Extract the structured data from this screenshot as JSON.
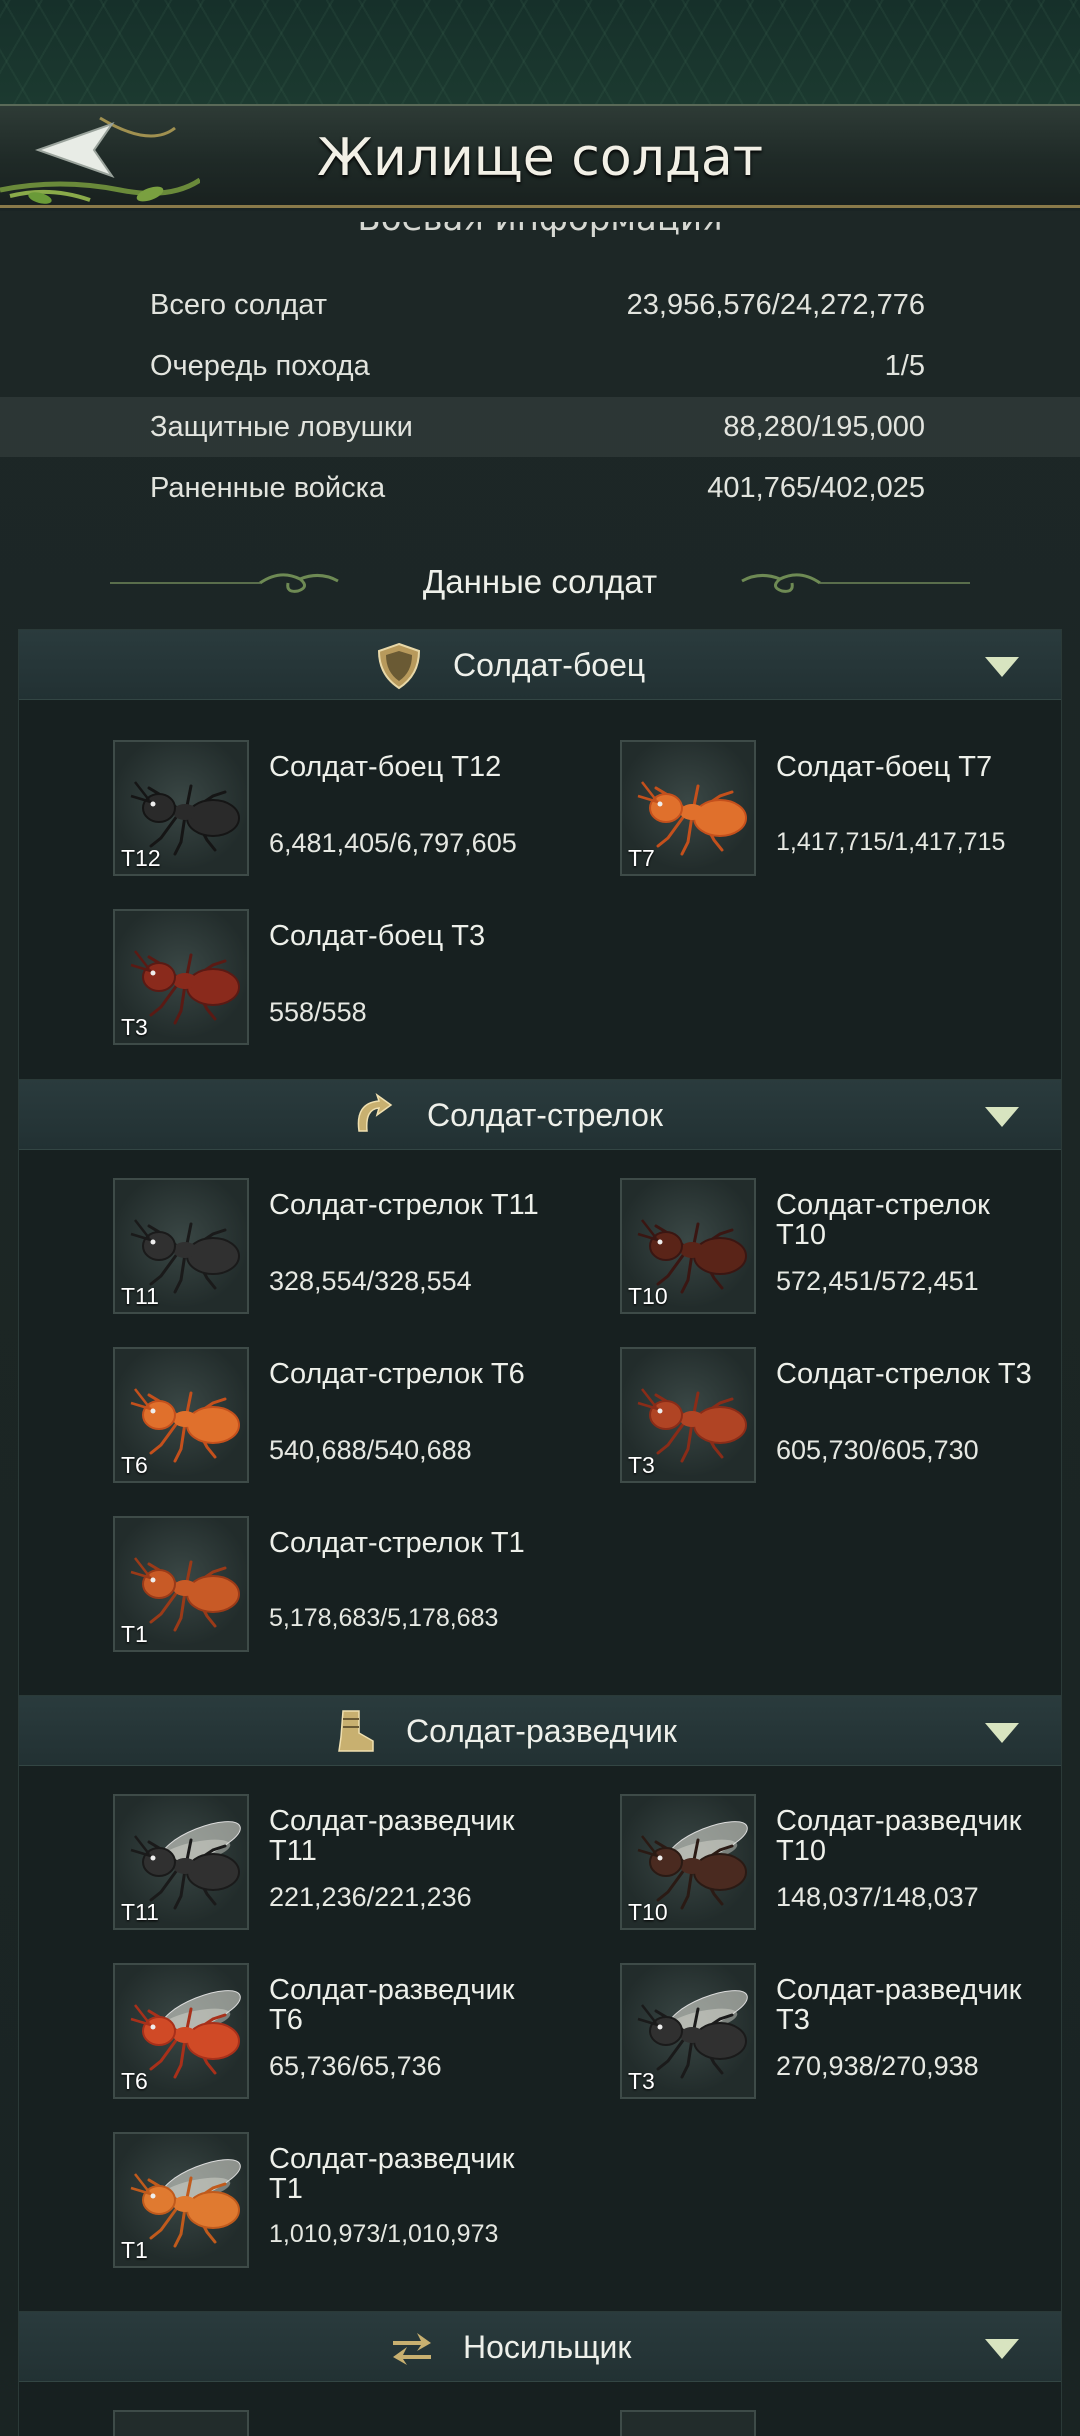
{
  "header": {
    "title": "Жилище солдат",
    "back_label": ""
  },
  "battle_info": {
    "title": "Боевая информация",
    "rows": [
      {
        "label": "Всего солдат",
        "value": "23,956,576/24,272,776"
      },
      {
        "label": "Очередь похода",
        "value": "1/5"
      },
      {
        "label": "Защитные ловушки",
        "value": "88,280/195,000"
      },
      {
        "label": "Раненные войска",
        "value": "401,765/402,025"
      }
    ]
  },
  "soldier_data_title": "Данные солдат",
  "sections": [
    {
      "name": "Солдат-боец",
      "icon": "shield-icon",
      "units": [
        {
          "name": "Солдат-боец T12",
          "count": "6,481,405/6,797,605",
          "tier": "T12"
        },
        {
          "name": "Солдат-боец T7",
          "count": "1,417,715/1,417,715",
          "tier": "T7"
        },
        {
          "name": "Солдат-боец T3",
          "count": "558/558",
          "tier": "T3"
        }
      ]
    },
    {
      "name": "Солдат-стрелок",
      "icon": "curved-arrow-icon",
      "units": [
        {
          "name": "Солдат-стрелок T11",
          "count": "328,554/328,554",
          "tier": "T11"
        },
        {
          "name": "Солдат-стрелок T10",
          "count": "572,451/572,451",
          "tier": "T10"
        },
        {
          "name": "Солдат-стрелок T6",
          "count": "540,688/540,688",
          "tier": "T6"
        },
        {
          "name": "Солдат-стрелок T3",
          "count": "605,730/605,730",
          "tier": "T3"
        },
        {
          "name": "Солдат-стрелок T1",
          "count": "5,178,683/5,178,683",
          "tier": "T1"
        }
      ]
    },
    {
      "name": "Солдат-разведчик",
      "icon": "boot-icon",
      "units": [
        {
          "name": "Солдат-разведчик T11",
          "count": "221,236/221,236",
          "tier": "T11"
        },
        {
          "name": "Солдат-разведчик T10",
          "count": "148,037/148,037",
          "tier": "T10"
        },
        {
          "name": "Солдат-разведчик T6",
          "count": "65,736/65,736",
          "tier": "T6"
        },
        {
          "name": "Солдат-разведчик T3",
          "count": "270,938/270,938",
          "tier": "T3"
        },
        {
          "name": "Солдат-разведчик T1",
          "count": "1,010,973/1,010,973",
          "tier": "T1"
        }
      ]
    },
    {
      "name": "Носильщик",
      "icon": "swap-arrows-icon",
      "units": []
    }
  ],
  "colors": {
    "accent_gold": "#c8b070",
    "chevron": "#d8e4c0",
    "ant_red": "#b8401a",
    "ant_black": "#1a1a1a"
  }
}
